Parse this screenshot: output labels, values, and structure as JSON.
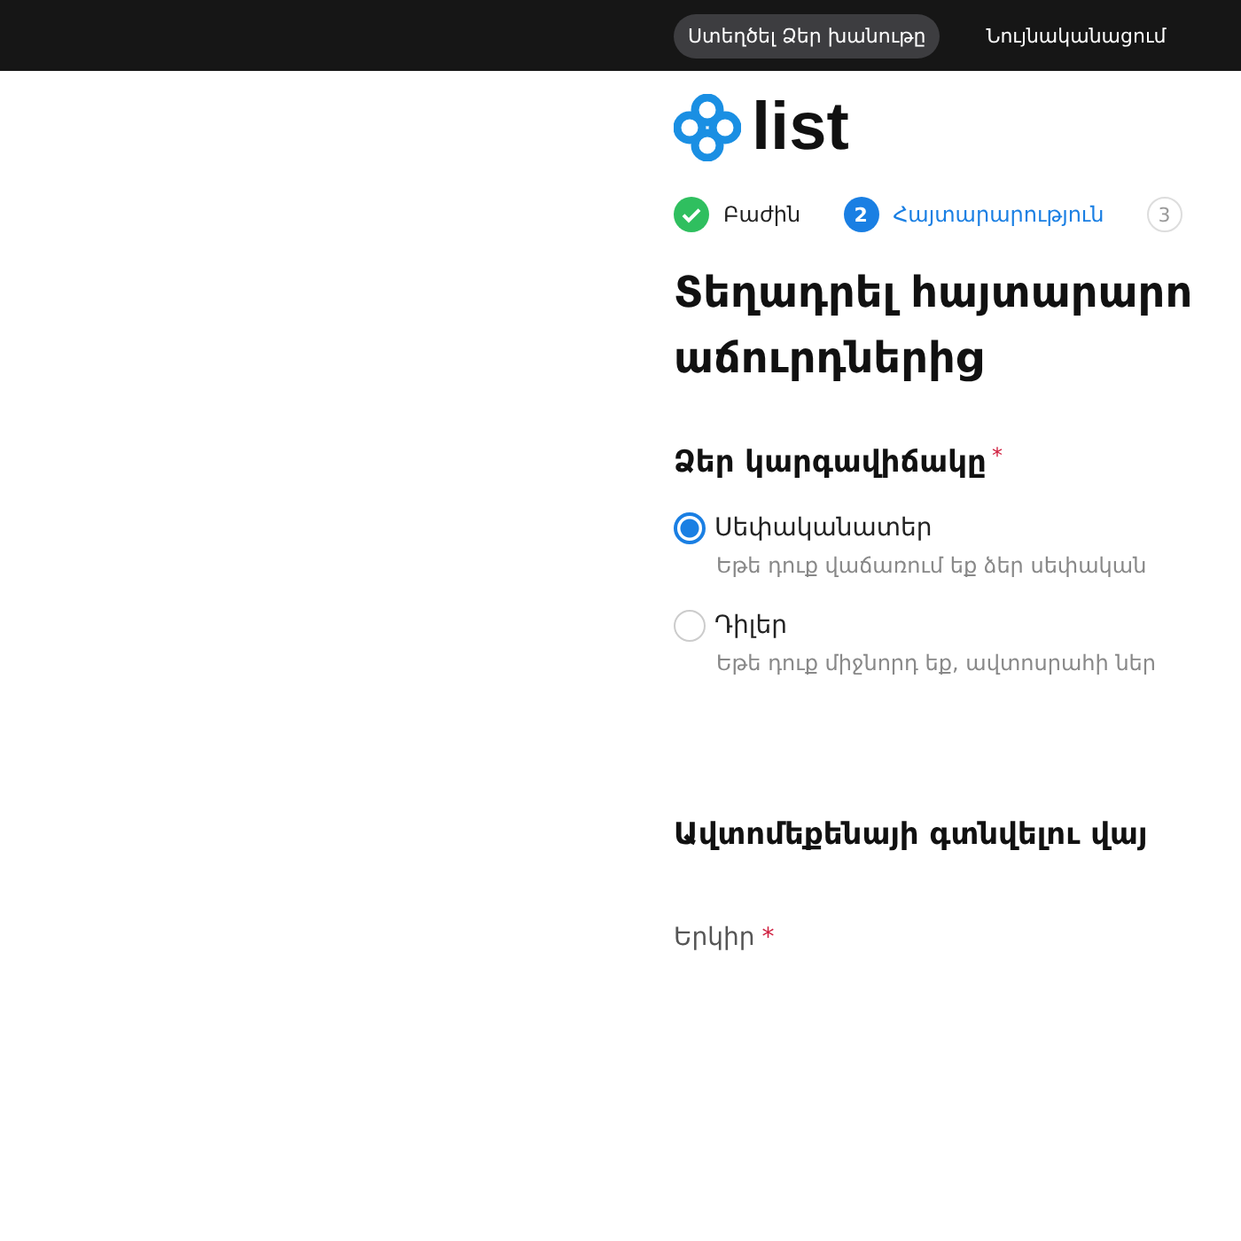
{
  "top_nav": {
    "items": [
      {
        "label": "Ստեղծել Ձեր խանութը",
        "selected": true
      },
      {
        "label": "Նույնականացում",
        "selected": false
      }
    ]
  },
  "logo": {
    "text": "list"
  },
  "steps": [
    {
      "label": "Բաժին",
      "completed": true,
      "selected": false
    },
    {
      "number": "2",
      "label": "Հայտարարություն",
      "completed": false,
      "selected": true
    },
    {
      "number": "3",
      "completed": false,
      "selected": false
    }
  ],
  "title": "Տեղադրել հայտարարո",
  "title_line_2": "աճուրդներից",
  "status_group": {
    "label": "Ձեր կարգավիճակը",
    "required_mark": "*",
    "options": [
      {
        "label": "Սեփականատեր",
        "hint": "Եթե դուք վաճառում եք ձեր սեփական",
        "selected": true
      },
      {
        "label": "Դիլեր",
        "hint": "Եթե դուք միջնորդ եք, ավտոսրահի ներ",
        "selected": false
      }
    ]
  },
  "location_section": {
    "heading": "Ավտոմեքենայի գտնվելու վայ",
    "field": {
      "label": "Երկիր",
      "required_mark": "*"
    }
  }
}
